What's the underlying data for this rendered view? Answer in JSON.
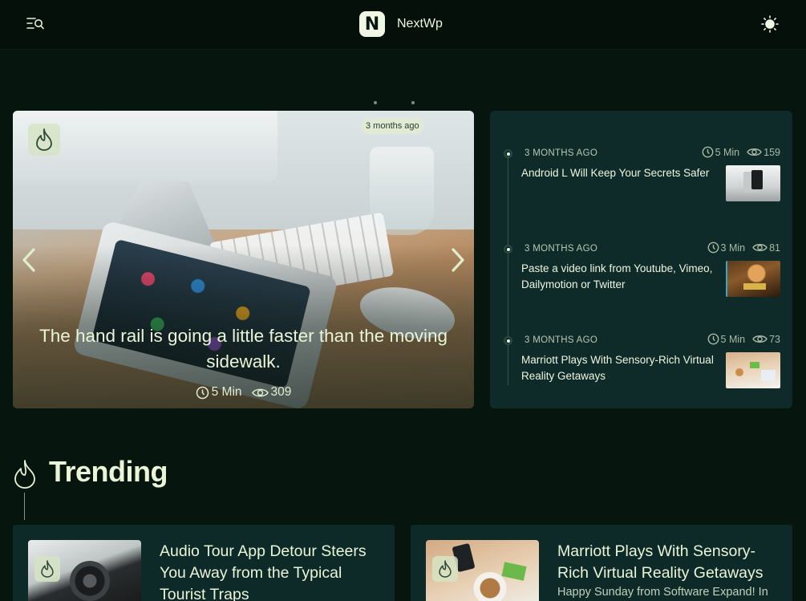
{
  "header": {
    "brand_letter": "N",
    "brand_name": "NextWp"
  },
  "hero": {
    "date": "3 months ago",
    "title": "The hand rail is going a little faster than the moving sidewalk.",
    "read_time": "5 Min",
    "views": "309"
  },
  "list": {
    "posts": [
      {
        "date": "3 MONTHS AGO",
        "read_time": "5 Min",
        "views": "159",
        "title": "Android L Will Keep Your Secrets Safer"
      },
      {
        "date": "3 MONTHS AGO",
        "read_time": "3 Min",
        "views": "81",
        "title": "Paste a video link from Youtube, Vimeo, Dailymotion or Twitter"
      },
      {
        "date": "3 MONTHS AGO",
        "read_time": "5 Min",
        "views": "73",
        "title": "Marriott Plays With Sensory-Rich Virtual Reality Getaways"
      }
    ]
  },
  "trending": {
    "heading": "Trending",
    "cards": [
      {
        "title": "Audio Tour App Detour Steers You Away from the Typical Tourist Traps",
        "excerpt": ""
      },
      {
        "title": "Marriott Plays With Sensory-Rich Virtual Reality Getaways",
        "excerpt": "Happy Sunday from Software Expand! In"
      }
    ]
  },
  "colors": {
    "background": "#06160f",
    "header": "#041009",
    "panel": "#0e2b29",
    "text": "#eaf5d8",
    "muted": "#b9c8b2"
  }
}
